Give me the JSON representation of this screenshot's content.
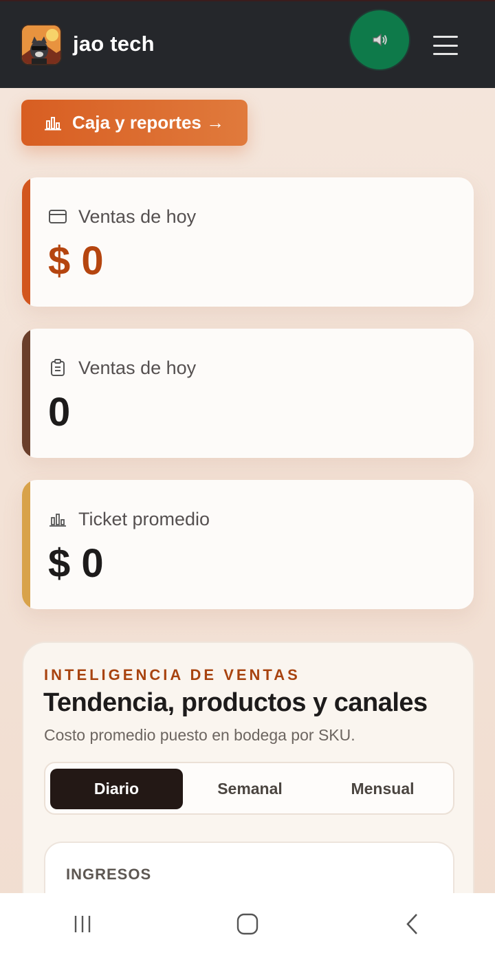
{
  "header": {
    "brand": "jao tech",
    "logo_icon": "raccoon-avatar",
    "sound_icon": "speaker-icon",
    "menu_icon": "hamburger-menu-icon"
  },
  "actions": {
    "caja_label": "Caja y reportes →"
  },
  "stats": [
    {
      "label": "Ventas de hoy",
      "value": "$ 0",
      "icon": "wallet-icon",
      "accent": "#d2561e",
      "value_color": "#b5450f"
    },
    {
      "label": "Ventas de hoy",
      "value": "0",
      "icon": "clipboard-icon",
      "accent": "#6a3e2a",
      "value_color": "#1d1b1b"
    },
    {
      "label": "Ticket promedio",
      "value": "$ 0",
      "icon": "chart-icon",
      "accent": "#d8a24a",
      "value_color": "#1d1b1b"
    }
  ],
  "intel": {
    "eyebrow": "INTELIGENCIA DE VENTAS",
    "title": "Tendencia, productos y canales",
    "subtitle": "Costo promedio puesto en bodega por SKU.",
    "tabs": [
      {
        "label": "Diario",
        "active": true
      },
      {
        "label": "Semanal",
        "active": false
      },
      {
        "label": "Mensual",
        "active": false
      }
    ],
    "panel_title": "INGRESOS"
  },
  "android_nav": {
    "recent": "recent-apps-icon",
    "home": "home-icon",
    "back": "back-icon"
  },
  "colors": {
    "header_bg": "#25272b",
    "sound_button": "#0e7a4a",
    "primary": "#d85e22"
  }
}
